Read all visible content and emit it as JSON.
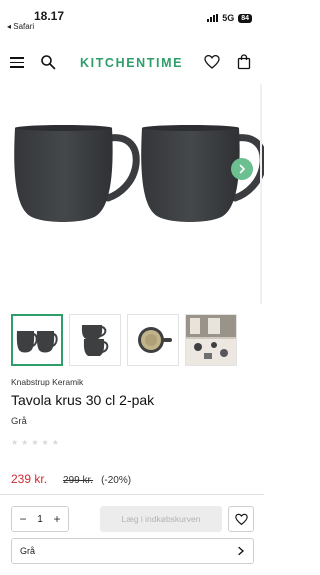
{
  "status_bar": {
    "time": "18.17",
    "back_app": "◂ Safari",
    "network": "5G",
    "battery": "84"
  },
  "header": {
    "logo": "KITCHENTIME"
  },
  "product": {
    "brand": "Knabstrup Keramik",
    "title": "Tavola krus 30 cl 2-pak",
    "variant": "Grå",
    "rating": 0,
    "price": "239 kr.",
    "old_price": "299 kr.",
    "discount": "(-20%)"
  },
  "gallery": {
    "active_index": 0,
    "thumbnails": [
      "mugs-pair",
      "mugs-stacked",
      "mug-top-view",
      "table-setting"
    ]
  },
  "buy": {
    "qty_minus": "−",
    "qty_plus": "+",
    "quantity": "1",
    "add_to_cart": "Læg i indkøbskurven",
    "color_selected": "Grå"
  },
  "colors": {
    "accent": "#2f9e6a",
    "price": "#d12b35",
    "arrow_bg": "#6cbf8f",
    "mug": "#3d3f40"
  }
}
